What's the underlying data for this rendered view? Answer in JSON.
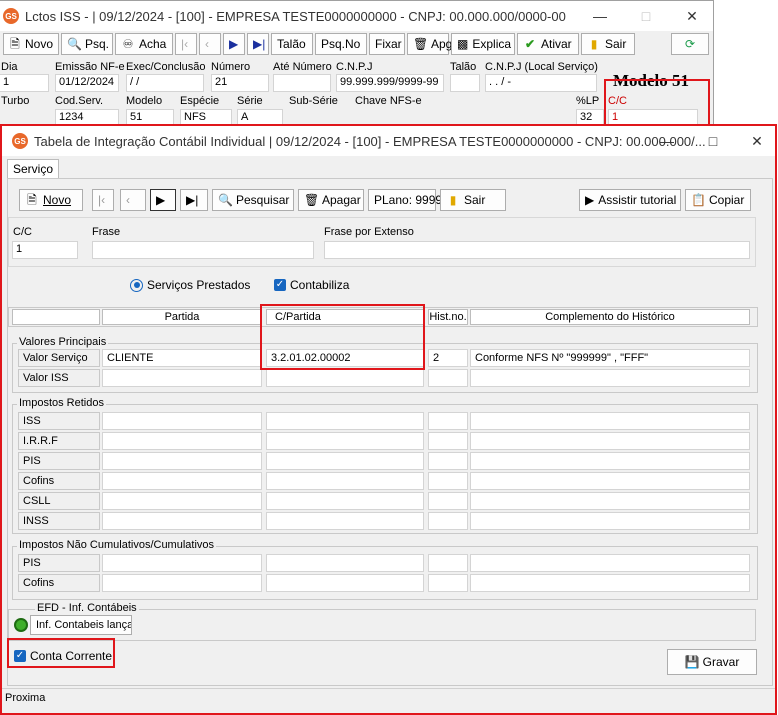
{
  "back": {
    "title": "Lctos ISS - |  09/12/2024 - [100] - EMPRESA TESTE0000000000 - CNPJ: 00.000.000/0000-00",
    "toolbar": {
      "novo": "Novo",
      "psq": "Psq.",
      "acha": "Acha",
      "talao": "Talão",
      "psqno": "Psq.No",
      "fixar": "Fixar",
      "apg": "Apg",
      "explica": "Explica",
      "ativar": "Ativar",
      "sair": "Sair"
    },
    "labels": {
      "dia": "Dia",
      "emissao": "Emissão NF-e",
      "exec": "Exec/Conclusão",
      "numero": "Número",
      "ate": "Até Número",
      "cnpj": "C.N.P.J",
      "talao": "Talão",
      "cnpj_local": "C.N.P.J (Local Serviço)",
      "turbo": "Turbo",
      "codserv": "Cod.Serv.",
      "modelo": "Modelo",
      "especie": "Espécie",
      "serie": "Série",
      "subserie": "Sub-Série",
      "chave": "Chave NFS-e",
      "lp": "%LP",
      "cc": "C/C"
    },
    "values": {
      "dia": "1",
      "emissao": "01/12/2024",
      "exec": "/  /",
      "numero": "21",
      "cnpj": "99.999.999/9999-99",
      "cnpj_local": ".   .   /   -",
      "codserv": "1234",
      "modelo": "51",
      "especie": "NFS",
      "serie": "A",
      "lp": "32",
      "cc": "1"
    },
    "modelo_note": "Modelo 51"
  },
  "front": {
    "title": "Tabela de Integração Contábil Individual  |  09/12/2024 - [100] - EMPRESA TESTE0000000000 - CNPJ: 00.000.000/...",
    "tab": "Serviço",
    "toolbar": {
      "novo": "Novo",
      "pesquisar": "Pesquisar",
      "apagar": "Apagar",
      "plano": "PLano: 9999",
      "sair": "Sair",
      "tutorial": "Assistir tutorial",
      "copiar": "Copiar"
    },
    "form": {
      "cc_label": "C/C",
      "cc_value": "1",
      "frase_label": "Frase",
      "frase_ext_label": "Frase por Extenso",
      "radio_label": "Serviços Prestados",
      "check_label": "Contabiliza"
    },
    "columns": {
      "partida": "Partida",
      "cpartida": "C/Partida",
      "hist": "Hist.no.",
      "complemento": "Complemento do Histórico"
    },
    "valores": {
      "title": "Valores Principais",
      "rows": [
        {
          "label": "Valor Serviço",
          "partida": "CLIENTE",
          "cpartida": "3.2.01.02.00002",
          "hist": "2",
          "comp": "Conforme NFS Nº \"999999\" , \"FFF\""
        },
        {
          "label": "Valor ISS",
          "partida": "",
          "cpartida": "",
          "hist": "",
          "comp": ""
        }
      ]
    },
    "retidos": {
      "title": "Impostos Retidos",
      "rows": [
        "ISS",
        "I.R.R.F",
        "PIS",
        "Cofins",
        "CSLL",
        "INSS"
      ]
    },
    "cumulativos": {
      "title": "Impostos Não Cumulativos/Cumulativos",
      "rows": [
        "PIS",
        "Cofins"
      ]
    },
    "efd": {
      "title": "EFD - Inf. Contábeis",
      "button": "Inf. Contabeis lançac"
    },
    "conta_corrente": "Conta Corrente",
    "gravar": "Gravar",
    "status": "Proxima"
  }
}
